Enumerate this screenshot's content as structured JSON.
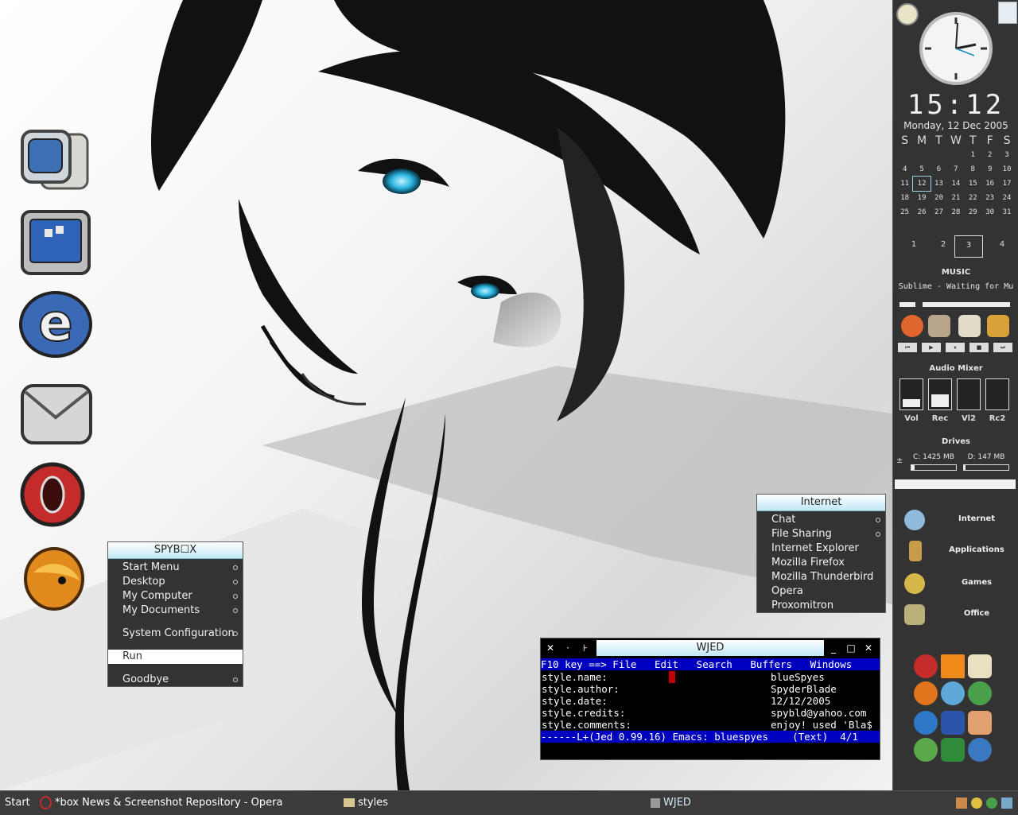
{
  "right_panel": {
    "time": "15:12",
    "date": "Monday, 12 Dec 2005",
    "calendar": {
      "weekdays": [
        "S",
        "M",
        "T",
        "W",
        "T",
        "F",
        "S"
      ],
      "weeks": [
        [
          "",
          "",
          "",
          "",
          "1",
          "2",
          "3"
        ],
        [
          "4",
          "5",
          "6",
          "7",
          "8",
          "9",
          "10"
        ],
        [
          "11",
          "12",
          "13",
          "14",
          "15",
          "16",
          "17"
        ],
        [
          "18",
          "19",
          "20",
          "21",
          "22",
          "23",
          "24"
        ],
        [
          "25",
          "26",
          "27",
          "28",
          "29",
          "30",
          "31"
        ]
      ],
      "today": "12"
    },
    "workspaces": [
      "1",
      "2",
      "3",
      "4"
    ],
    "active_workspace": "3",
    "music_title": "MUSIC",
    "music_track": "Sublime - Waiting for Mu",
    "audio_mixer_title": "Audio Mixer",
    "mixer_channels": [
      "Vol",
      "Rec",
      "Vl2",
      "Rc2"
    ],
    "drives_title": "Drives",
    "drive_c": "C: 1425 MB",
    "drive_d": "D: 147 MB",
    "drive_toggle": "±",
    "launchers": [
      "Internet",
      "Applications",
      "Games",
      "Office"
    ]
  },
  "spybox_menu": {
    "title": "SPYB☐X",
    "items": [
      "Start Menu",
      "Desktop",
      "My Computer",
      "My Documents"
    ],
    "system_configuration": "System Configuration",
    "run": "Run",
    "goodbye": "Goodbye"
  },
  "internet_menu": {
    "title": "Internet",
    "items": [
      "Chat",
      "File Sharing",
      "Internet Explorer",
      "Mozilla Firefox",
      "Mozilla Thunderbird",
      "Opera",
      "Proxomitron"
    ]
  },
  "wjed": {
    "title": "WJED",
    "menubar": "F10 key ==> File   Edit   Search   Buffers   Windows",
    "lines": [
      {
        "key": "style.name:",
        "value": "blueSpyes"
      },
      {
        "key": "style.author:",
        "value": "SpyderBlade"
      },
      {
        "key": "style.date:",
        "value": "12/12/2005"
      },
      {
        "key": "style.credits:",
        "value": "spybld@yahoo.com"
      },
      {
        "key": "style.comments:",
        "value": "enjoy! used 'Bla$"
      }
    ],
    "status": "------L+(Jed 0.99.16) Emacs: bluespyes    (Text)  4/1"
  },
  "taskbar": {
    "start": "Start",
    "opera_task": "*box News & Screenshot Repository - Opera",
    "styles_task": "styles",
    "wjed_task": "WJED"
  },
  "colors": {
    "panel_bg": "#333333",
    "menu_bg": "#333333",
    "title_gradient_end": "#bfe7f5",
    "jed_blue": "#0000c0",
    "eye_accent": "#2bb3e0"
  }
}
